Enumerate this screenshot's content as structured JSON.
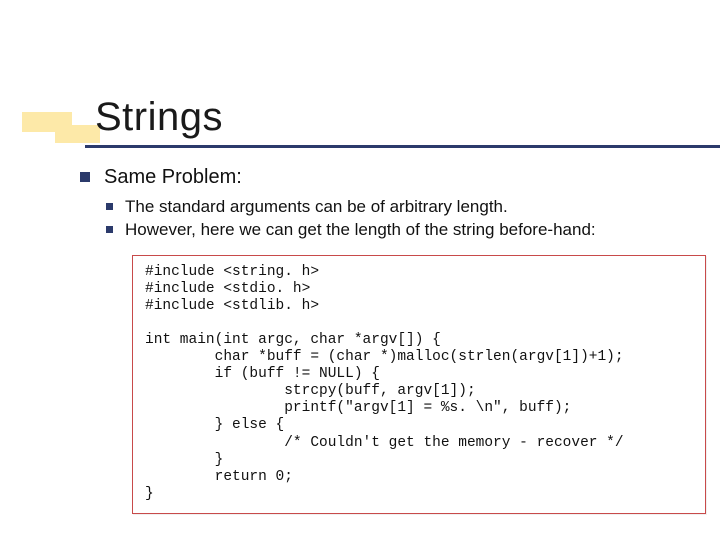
{
  "slide": {
    "title": "Strings",
    "heading": "Same Problem:",
    "points": [
      "The standard arguments can be of arbitrary length.",
      "However, here we can get the length of the string before-hand:"
    ],
    "code": "#include <string. h>\n#include <stdio. h>\n#include <stdlib. h>\n\nint main(int argc, char *argv[]) {\n        char *buff = (char *)malloc(strlen(argv[1])+1);\n        if (buff != NULL) {\n                strcpy(buff, argv[1]);\n                printf(\"argv[1] = %s. \\n\", buff);\n        } else {\n                /* Couldn't get the memory - recover */\n        }\n        return 0;\n}"
  }
}
